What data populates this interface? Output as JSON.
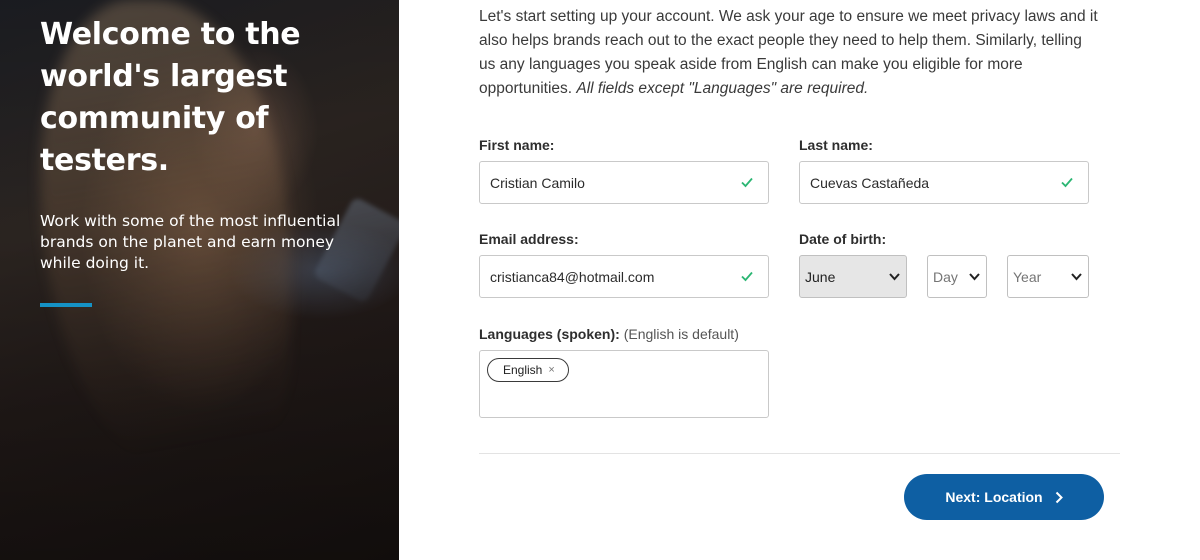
{
  "hero": {
    "title": "Welcome to the world's largest community of testers.",
    "subtitle": "Work with some of the most influential brands on the planet and earn money while doing it.",
    "accent_color": "#1592c5"
  },
  "intro": {
    "text": "Let's start setting up your account. We ask your age to ensure we meet privacy laws and it also helps brands reach out to the exact people they need to help them. Similarly, telling us any languages you speak aside from English can make you eligible for more opportunities.",
    "required_note": "All fields except \"Languages\" are required."
  },
  "form": {
    "first_name": {
      "label": "First name:",
      "value": "Cristian Camilo",
      "valid_icon": "check-icon"
    },
    "last_name": {
      "label": "Last name:",
      "value": "Cuevas Castañeda",
      "valid_icon": "check-icon"
    },
    "email": {
      "label": "Email address:",
      "value": "cristianca84@hotmail.com",
      "valid_icon": "check-icon"
    },
    "dob": {
      "label": "Date of birth:",
      "month": "June",
      "day": "Day",
      "year": "Year"
    },
    "languages": {
      "label": "Languages (spoken):",
      "hint": "(English is default)",
      "chips": [
        "English"
      ],
      "chip_remove": "×"
    }
  },
  "actions": {
    "next_label": "Next: Location",
    "next_color": "#0e5fa3"
  },
  "colors": {
    "valid_check": "#2bb673"
  }
}
